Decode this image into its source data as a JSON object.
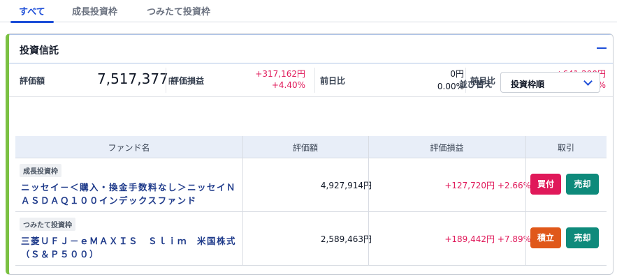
{
  "tabs": [
    {
      "label": "すべて"
    },
    {
      "label": "成長投資枠"
    },
    {
      "label": "つみたて投資枠"
    }
  ],
  "card": {
    "title": "投資信託",
    "summary": {
      "valuation_label": "評価額",
      "valuation_value": "7,517,377",
      "valuation_unit": "円",
      "pl_label": "評価損益",
      "pl_amount": "+317,162円",
      "pl_percent": "+4.40%",
      "day_label": "前日比",
      "day_amount": "0円",
      "day_percent": "0.00%",
      "month_label": "前月比",
      "month_amount": "+641,290円",
      "month_percent": "+9.32%"
    },
    "sort": {
      "label": "並び替え",
      "selected": "投資枠順"
    },
    "table": {
      "headers": [
        "ファンド名",
        "評価額",
        "評価損益",
        "取引"
      ],
      "rows": [
        {
          "badge": "成長投資枠",
          "fund_name": "ニッセイ－＜購入・換金手数料なし＞ニッセイＮＡＳＤＡＱ１００インデックスファンド",
          "amount": "4,927,914円",
          "gain": "+127,720円 +2.66%",
          "action1": "買付",
          "action2": "売却"
        },
        {
          "badge": "つみたて投資枠",
          "fund_name": "三菱ＵＦＪ－ｅＭＡＸＩＳ　Ｓｌｉｍ　米国株式（Ｓ＆Ｐ５００）",
          "amount": "2,589,463円",
          "gain": "+189,442円 +7.89%",
          "action1": "積立",
          "action2": "売却"
        }
      ]
    }
  },
  "colors": {
    "accent": "#1d4ed8",
    "positive": "#e0195a",
    "sell": "#0e8a7b",
    "accumulate": "#e0581a",
    "card_border_left": "#7bc143"
  },
  "icons": {
    "collapse": "minus-icon",
    "dropdown": "chevron-down-icon"
  }
}
